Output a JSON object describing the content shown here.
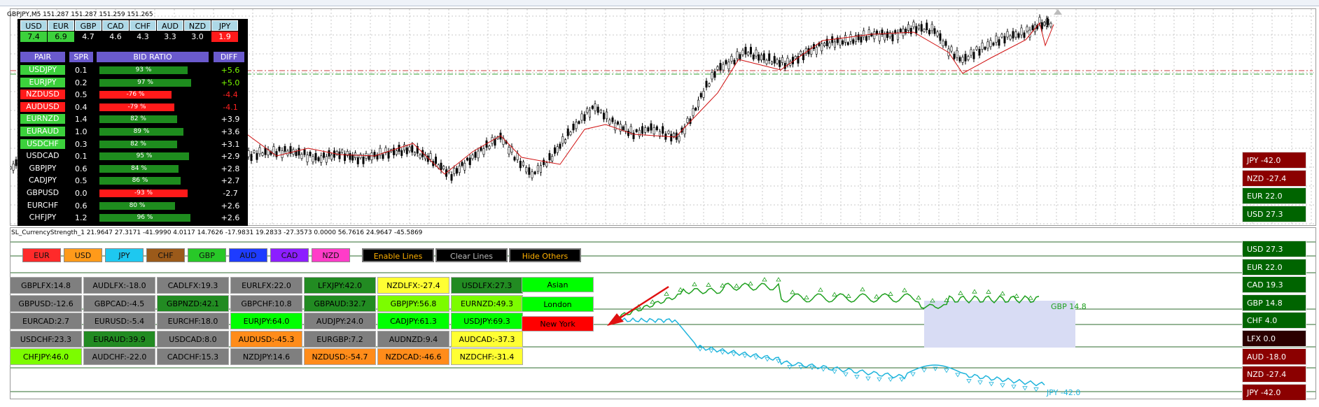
{
  "chart": {
    "title": "GBPJPY,M5  151.287 151.287 151.259 151.265"
  },
  "indicator": {
    "title": "SL_CurrencyStrength_1 21.9647 27.3171 -41.9990 4.0117 14.7626 -17.9831 19.2833 -27.3573 0.0000 56.7616 24.9647 -45.5869"
  },
  "dashboard": {
    "currencies": [
      "USD",
      "EUR",
      "GBP",
      "CAD",
      "CHF",
      "AUD",
      "NZD",
      "JPY"
    ],
    "values": [
      {
        "text": "7.4",
        "bg": "#3cd13c"
      },
      {
        "text": "6.9",
        "bg": "#3cd13c"
      },
      {
        "text": "4.7",
        "bg": "#000000"
      },
      {
        "text": "4.6",
        "bg": "#000000"
      },
      {
        "text": "4.3",
        "bg": "#000000"
      },
      {
        "text": "3.3",
        "bg": "#000000"
      },
      {
        "text": "3.0",
        "bg": "#000000"
      },
      {
        "text": "1.9",
        "bg": "#ff1a1a"
      }
    ],
    "headers": {
      "pair": "PAIR",
      "spr": "SPR",
      "bid": "BID RATIO",
      "diff": "DIFF"
    },
    "rows": [
      {
        "pair": "USDJPY",
        "pair_bg": "#3cd13c",
        "spr": "0.1",
        "pct": "93 %",
        "bar_w": 0.93,
        "bar_bg": "#1e8c1e",
        "diff": "+5.6",
        "diff_color": "#7cfc00"
      },
      {
        "pair": "EURJPY",
        "pair_bg": "#3cd13c",
        "spr": "0.2",
        "pct": "97 %",
        "bar_w": 0.97,
        "bar_bg": "#1e8c1e",
        "diff": "+5.0",
        "diff_color": "#7cfc00"
      },
      {
        "pair": "NZDUSD",
        "pair_bg": "#ff1a1a",
        "spr": "0.5",
        "pct": "-76 %",
        "bar_w": 0.76,
        "bar_bg": "#ff1a1a",
        "diff": "-4.4",
        "diff_color": "#ff2020"
      },
      {
        "pair": "AUDUSD",
        "pair_bg": "#ff1a1a",
        "spr": "0.4",
        "pct": "-79 %",
        "bar_w": 0.79,
        "bar_bg": "#ff1a1a",
        "diff": "-4.1",
        "diff_color": "#ff2020"
      },
      {
        "pair": "EURNZD",
        "pair_bg": "#3cd13c",
        "spr": "1.4",
        "pct": "82 %",
        "bar_w": 0.82,
        "bar_bg": "#1e8c1e",
        "diff": "+3.9",
        "diff_color": "#ffffff"
      },
      {
        "pair": "EURAUD",
        "pair_bg": "#3cd13c",
        "spr": "1.0",
        "pct": "89 %",
        "bar_w": 0.89,
        "bar_bg": "#1e8c1e",
        "diff": "+3.6",
        "diff_color": "#ffffff"
      },
      {
        "pair": "USDCHF",
        "pair_bg": "#3cd13c",
        "spr": "0.3",
        "pct": "82 %",
        "bar_w": 0.82,
        "bar_bg": "#1e8c1e",
        "diff": "+3.1",
        "diff_color": "#ffffff"
      },
      {
        "pair": "USDCAD",
        "pair_bg": "#000000",
        "spr": "0.1",
        "pct": "95 %",
        "bar_w": 0.95,
        "bar_bg": "#1e8c1e",
        "diff": "+2.9",
        "diff_color": "#ffffff"
      },
      {
        "pair": "GBPJPY",
        "pair_bg": "#000000",
        "spr": "0.6",
        "pct": "84 %",
        "bar_w": 0.84,
        "bar_bg": "#1e8c1e",
        "diff": "+2.8",
        "diff_color": "#ffffff"
      },
      {
        "pair": "CADJPY",
        "pair_bg": "#000000",
        "spr": "0.5",
        "pct": "86 %",
        "bar_w": 0.86,
        "bar_bg": "#1e8c1e",
        "diff": "+2.7",
        "diff_color": "#ffffff"
      },
      {
        "pair": "GBPUSD",
        "pair_bg": "#000000",
        "spr": "0.0",
        "pct": "-93 %",
        "bar_w": 0.93,
        "bar_bg": "#ff1a1a",
        "diff": "-2.7",
        "diff_color": "#ffffff"
      },
      {
        "pair": "EURCHF",
        "pair_bg": "#000000",
        "spr": "0.6",
        "pct": "80 %",
        "bar_w": 0.8,
        "bar_bg": "#1e8c1e",
        "diff": "+2.6",
        "diff_color": "#ffffff"
      },
      {
        "pair": "CHFJPY",
        "pair_bg": "#000000",
        "spr": "1.2",
        "pct": "96 %",
        "bar_w": 0.96,
        "bar_bg": "#1e8c1e",
        "diff": "+2.6",
        "diff_color": "#ffffff"
      }
    ]
  },
  "top_side": [
    {
      "label": "JPY  -42.0",
      "bg": "#8b0000"
    },
    {
      "label": "NZD  -27.4",
      "bg": "#8b0000"
    },
    {
      "label": "EUR  22.0",
      "bg": "#006400"
    },
    {
      "label": "USD  27.3",
      "bg": "#006400"
    }
  ],
  "bottom_side": [
    {
      "label": "USD  27.3",
      "bg": "#006400"
    },
    {
      "label": "EUR  22.0",
      "bg": "#006400"
    },
    {
      "label": "CAD  19.3",
      "bg": "#006400"
    },
    {
      "label": "GBP  14.8",
      "bg": "#006400"
    },
    {
      "label": "CHF  4.0",
      "bg": "#006400"
    },
    {
      "label": "LFX  0.0",
      "bg": "#2a0000"
    },
    {
      "label": "AUD  -18.0",
      "bg": "#8b0000"
    },
    {
      "label": "NZD  -27.4",
      "bg": "#8b0000"
    },
    {
      "label": "JPY  -42.0",
      "bg": "#8b0000"
    }
  ],
  "currency_buttons": [
    {
      "label": "EUR",
      "bg": "#ff2a2a",
      "color": "#111"
    },
    {
      "label": "USD",
      "bg": "#ff9a1a",
      "color": "#111"
    },
    {
      "label": "JPY",
      "bg": "#1ec8f0",
      "color": "#111"
    },
    {
      "label": "CHF",
      "bg": "#9b5a1a",
      "color": "#111"
    },
    {
      "label": "GBP",
      "bg": "#28c828",
      "color": "#111"
    },
    {
      "label": "AUD",
      "bg": "#1e3cff",
      "color": "#111"
    },
    {
      "label": "CAD",
      "bg": "#8c1eff",
      "color": "#111"
    },
    {
      "label": "NZD",
      "bg": "#ff3cc8",
      "color": "#111"
    }
  ],
  "line_buttons": {
    "enable": {
      "label": "Enable Lines",
      "color": "#ffb000"
    },
    "clear": {
      "label": "Clear Lines",
      "color": "#bbbbbb"
    },
    "hide": {
      "label": "Hide Others",
      "color": "#ffb000"
    }
  },
  "strength_grid": [
    [
      {
        "text": "GBPLFX:14.8",
        "bg": "#7f7f7f"
      },
      {
        "text": "AUDLFX:-18.0",
        "bg": "#7f7f7f"
      },
      {
        "text": "CADLFX:19.3",
        "bg": "#7f7f7f"
      },
      {
        "text": "EURLFX:22.0",
        "bg": "#7f7f7f"
      },
      {
        "text": "LFXJPY:42.0",
        "bg": "#228b22"
      },
      {
        "text": "NZDLFX:-27.4",
        "bg": "#ffff33"
      },
      {
        "text": "USDLFX:27.3",
        "bg": "#228b22"
      }
    ],
    [
      {
        "text": "GBPUSD:-12.6",
        "bg": "#7f7f7f"
      },
      {
        "text": "GBPCAD:-4.5",
        "bg": "#7f7f7f"
      },
      {
        "text": "GBPNZD:42.1",
        "bg": "#228b22"
      },
      {
        "text": "GBPCHF:10.8",
        "bg": "#7f7f7f"
      },
      {
        "text": "GBPAUD:32.7",
        "bg": "#228b22"
      },
      {
        "text": "GBPJPY:56.8",
        "bg": "#7cfc00"
      },
      {
        "text": "EURNZD:49.3",
        "bg": "#7cfc00"
      }
    ],
    [
      {
        "text": "EURCAD:2.7",
        "bg": "#7f7f7f"
      },
      {
        "text": "EURUSD:-5.4",
        "bg": "#7f7f7f"
      },
      {
        "text": "EURCHF:18.0",
        "bg": "#7f7f7f"
      },
      {
        "text": "EURJPY:64.0",
        "bg": "#00ff00"
      },
      {
        "text": "AUDJPY:24.0",
        "bg": "#7f7f7f"
      },
      {
        "text": "CADJPY:61.3",
        "bg": "#00ff00"
      },
      {
        "text": "USDJPY:69.3",
        "bg": "#00ff00"
      }
    ],
    [
      {
        "text": "USDCHF:23.3",
        "bg": "#7f7f7f"
      },
      {
        "text": "EURAUD:39.9",
        "bg": "#228b22"
      },
      {
        "text": "USDCAD:8.0",
        "bg": "#7f7f7f"
      },
      {
        "text": "AUDUSD:-45.3",
        "bg": "#ff8c1a"
      },
      {
        "text": "EURGBP:7.2",
        "bg": "#7f7f7f"
      },
      {
        "text": "AUDNZD:9.4",
        "bg": "#7f7f7f"
      },
      {
        "text": "AUDCAD:-37.3",
        "bg": "#ffff33"
      }
    ],
    [
      {
        "text": "CHFJPY:46.0",
        "bg": "#7cfc00"
      },
      {
        "text": "AUDCHF:-22.0",
        "bg": "#7f7f7f"
      },
      {
        "text": "CADCHF:15.3",
        "bg": "#7f7f7f"
      },
      {
        "text": "NZDJPY:14.6",
        "bg": "#7f7f7f"
      },
      {
        "text": "NZDUSD:-54.7",
        "bg": "#ff8c1a"
      },
      {
        "text": "NZDCAD:-46.6",
        "bg": "#ff8c1a"
      },
      {
        "text": "NZDCHF:-31.4",
        "bg": "#ffff33"
      }
    ]
  ],
  "sessions": [
    {
      "label": "Asian",
      "bg": "#00ff00"
    },
    {
      "label": "London",
      "bg": "#00ff00"
    },
    {
      "label": "New York",
      "bg": "#ff0000"
    }
  ],
  "line_labels": {
    "gbp": "GBP 14.8",
    "jpy": "JPY -42.0"
  },
  "colors": {
    "gbp_line": "#1ea01e",
    "jpy_line": "#1eb4dc",
    "highlight": "#d8dcf4",
    "arrow": "#e01010"
  }
}
